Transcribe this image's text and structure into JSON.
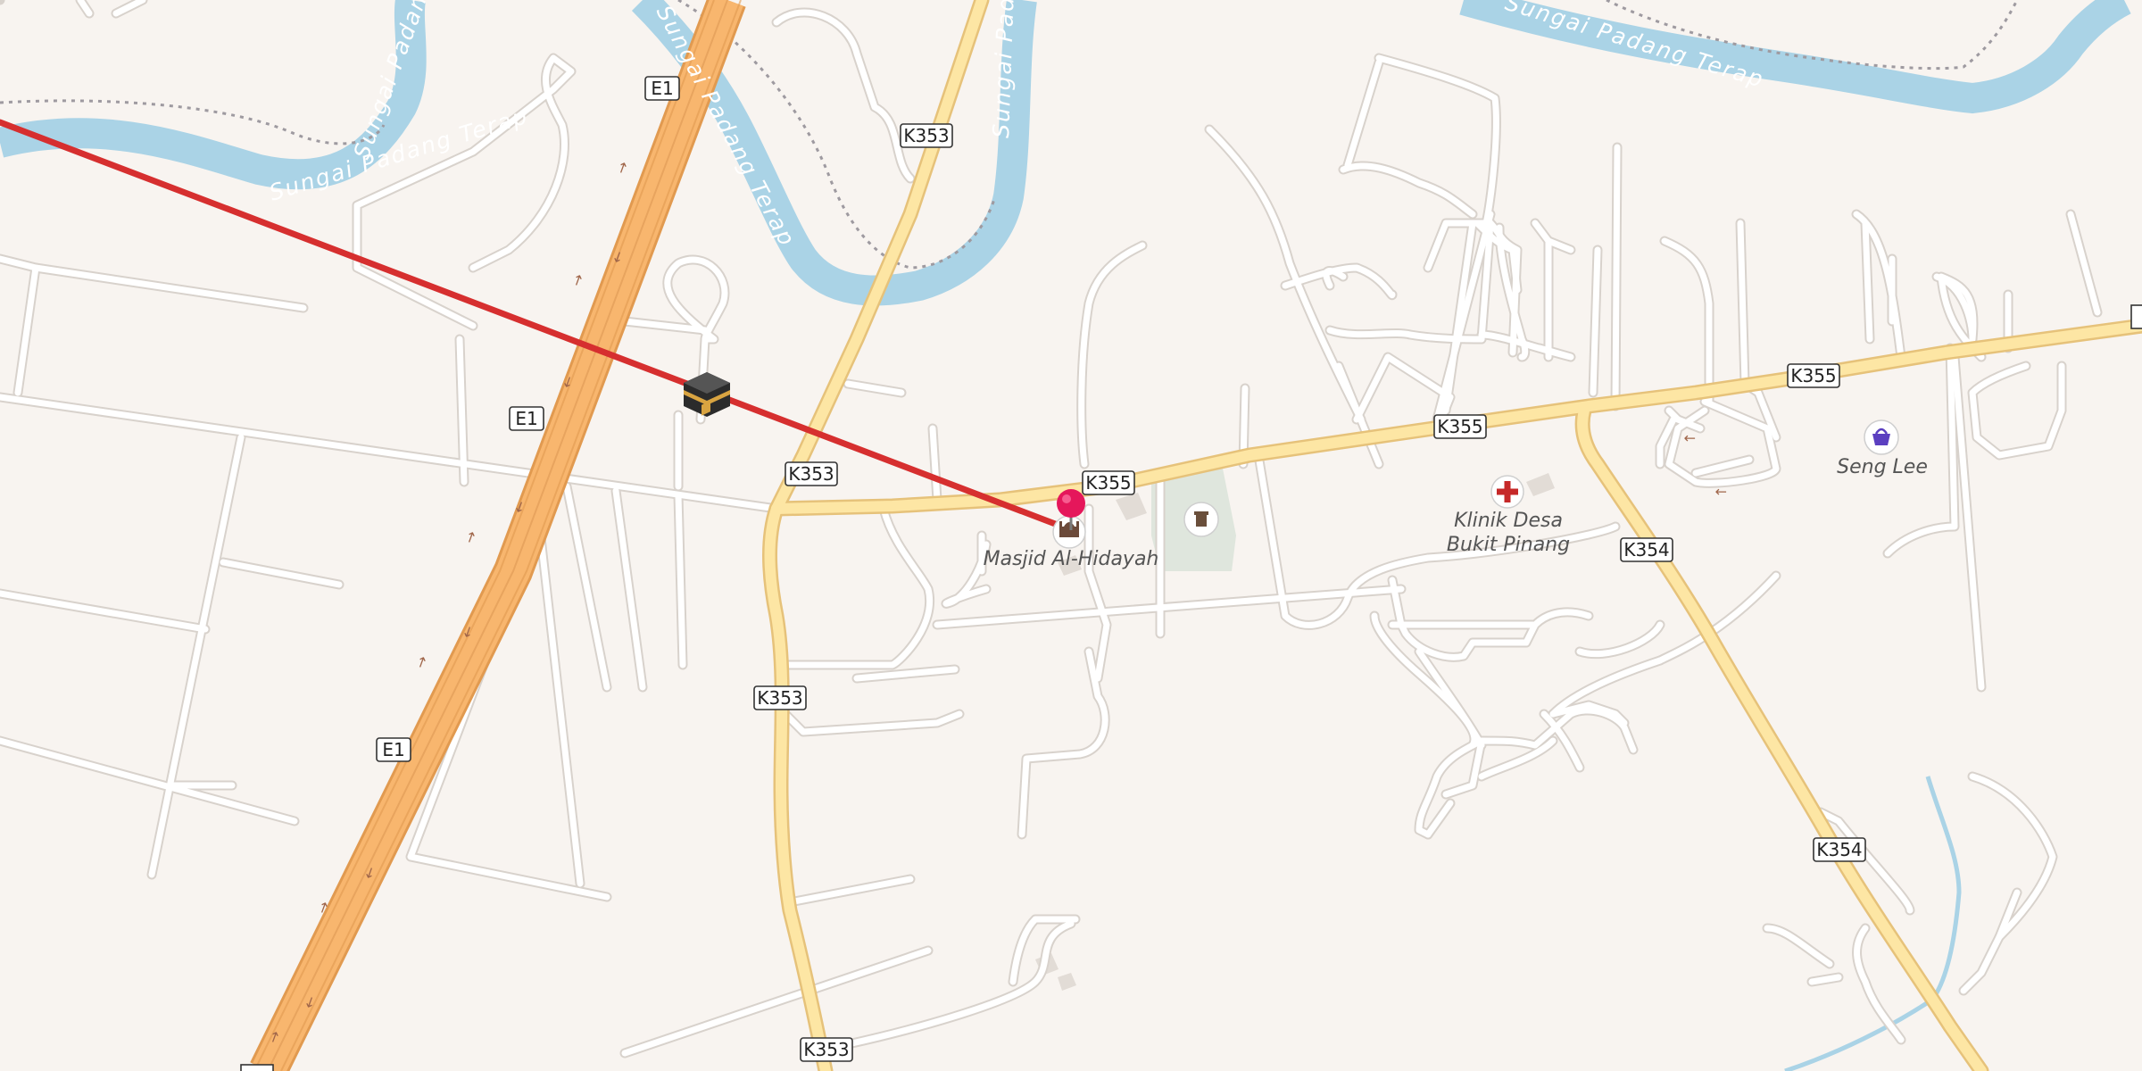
{
  "colors": {
    "background": "#f8f4f0",
    "water": "#aad3e6",
    "water_label": "#ffffff",
    "minor_road": "#ffffff",
    "minor_road_casing": "#d8d2cc",
    "secondary_road": "#fde6a4",
    "secondary_road_casing": "#e6c27a",
    "motorway": "#f8b66e",
    "motorway_casing": "#e19a50",
    "route_line": "#d62f2f",
    "marker": "#e5175b",
    "boundary": "#9e9aa0",
    "cemetery": "#dfe6dd"
  },
  "route_shields": [
    {
      "ref": "E1"
    },
    {
      "ref": "E1"
    },
    {
      "ref": "E1"
    },
    {
      "ref": "K353"
    },
    {
      "ref": "K353"
    },
    {
      "ref": "K353"
    },
    {
      "ref": "K353"
    },
    {
      "ref": "K355"
    },
    {
      "ref": "K355"
    },
    {
      "ref": "K355"
    },
    {
      "ref": "K354"
    },
    {
      "ref": "K354"
    }
  ],
  "water_labels": [
    {
      "text": "Sungai Padang Terap"
    },
    {
      "text": "Sungai Padang Terap"
    },
    {
      "text": "Sungai Padang Terap"
    },
    {
      "text": "Sungai Padang Terap"
    },
    {
      "text": "Sungai Padang Terap"
    }
  ],
  "pois": {
    "mosque": {
      "name": "Masjid Al-Hidayah",
      "icon": "mosque-icon"
    },
    "clinic": {
      "name_line1": "Klinik Desa",
      "name_line2": "Bukit Pinang",
      "icon": "hospital-cross-icon"
    },
    "shop": {
      "name": "Seng Lee",
      "icon": "shopping-basket-icon"
    },
    "cemetery": {
      "icon": "cemetery-icon"
    },
    "qibla": {
      "icon": "kaaba-icon"
    },
    "selected": {
      "icon": "map-pin-icon"
    }
  }
}
